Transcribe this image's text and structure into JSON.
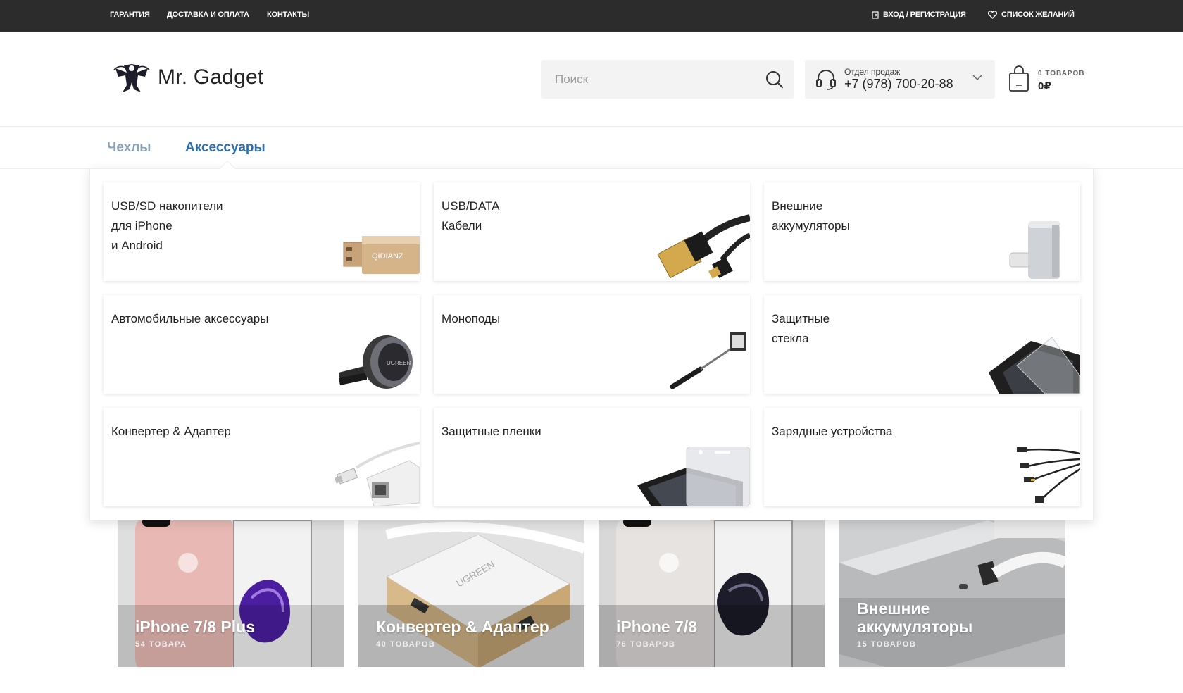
{
  "topbar": {
    "links": [
      "ГАРАНТИЯ",
      "ДОСТАВКА И ОПЛАТА",
      "КОНТАКТЫ"
    ],
    "login": "ВХОД / РЕГИСТРАЦИЯ",
    "wishlist": "СПИСОК ЖЕЛАНИЙ"
  },
  "header": {
    "logo_text": "Mr. Gadget",
    "search_placeholder": "Поиск",
    "phone_label": "Отдел продаж",
    "phone_number": "+7 (978) 700-20-88",
    "cart_count": "0 ТОВАРОВ",
    "cart_sum": "0₽"
  },
  "nav": {
    "items": [
      "Чехлы",
      "Аксессуары"
    ],
    "active": "Аксессуары"
  },
  "menu": {
    "cards": [
      {
        "label": "USB/SD накопители\nдля iPhone\nи Android",
        "icon": "usb-flash-icon"
      },
      {
        "label": "USB/DATA\nКабели",
        "icon": "usb-cable-icon"
      },
      {
        "label": "Внешние\nаккумуляторы",
        "icon": "power-bank-icon"
      },
      {
        "label": "Автомобильные аксессуары",
        "icon": "car-mount-icon"
      },
      {
        "label": "Моноподы",
        "icon": "selfie-stick-icon"
      },
      {
        "label": "Защитные\nстекла",
        "icon": "screen-glass-icon"
      },
      {
        "label": "Конвертер & Адаптер",
        "icon": "adapter-icon"
      },
      {
        "label": "Защитные пленки",
        "icon": "screen-film-icon"
      },
      {
        "label": "Зарядные устройства",
        "icon": "charger-cables-icon"
      }
    ]
  },
  "tiles": [
    {
      "title": "iPhone 7/8 Plus",
      "count": "54 ТОВАРА"
    },
    {
      "title": "Конвертер & Адаптер",
      "count": "40 ТОВАРОВ"
    },
    {
      "title": "iPhone 7/8",
      "count": "76 ТОВАРОВ"
    },
    {
      "title": "Внешние\nаккумуляторы",
      "count": "15 ТОВАРОВ"
    }
  ],
  "colors": {
    "topbar": "#2c2c2c",
    "nav_active": "#2d6eb1",
    "nav_inactive": "#8aa3bb"
  }
}
